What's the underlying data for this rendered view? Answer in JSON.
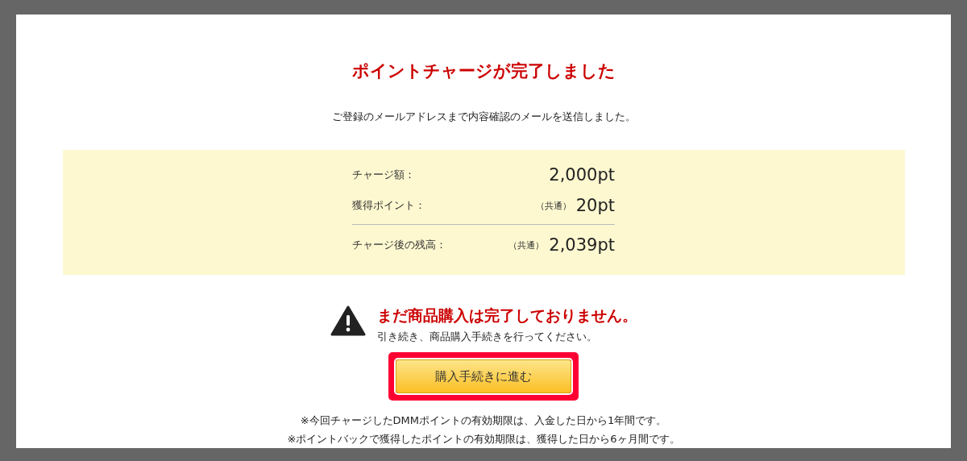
{
  "title": "ポイントチャージが完了しました",
  "message": "ご登録のメールアドレスまで内容確認のメールを送信しました。",
  "summary": {
    "rows": [
      {
        "label": "チャージ額：",
        "note": "",
        "value": "2,000pt"
      },
      {
        "label": "獲得ポイント：",
        "note": "（共通）",
        "value": "20pt"
      }
    ],
    "total": {
      "label": "チャージ後の残高：",
      "note": "（共通）",
      "value": "2,039pt"
    }
  },
  "warning": {
    "heading": "まだ商品購入は完了しておりません。",
    "text": "引き続き、商品購入手続きを行ってください。"
  },
  "button": {
    "label": "購入手続きに進む",
    "highlighted": true
  },
  "notes": [
    "※今回チャージしたDMMポイントの有効期限は、入金した日から1年間です。",
    "※ポイントバックで獲得したポイントの有効期限は、獲得した日から6ヶ月間です。"
  ]
}
